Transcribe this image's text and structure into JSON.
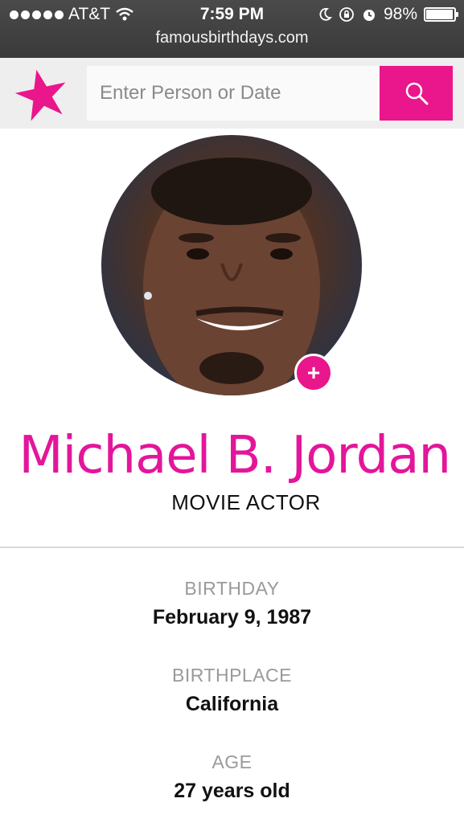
{
  "status_bar": {
    "carrier": "AT&T",
    "time": "7:59 PM",
    "battery": "98%",
    "battery_level": 0.98,
    "url": "famousbirthdays.com"
  },
  "header": {
    "logo_icon": "star-logo-icon",
    "search_placeholder": "Enter Person or Date",
    "search_icon": "search-icon",
    "accent_color": "#e9168c"
  },
  "profile": {
    "name": "Michael B. Jordan",
    "profession": "MOVIE ACTOR",
    "add_label": "+"
  },
  "stats": [
    {
      "label": "BIRTHDAY",
      "value": "February 9, 1987"
    },
    {
      "label": "BIRTHPLACE",
      "value": "California"
    },
    {
      "label": "AGE",
      "value": "27 years old"
    }
  ]
}
